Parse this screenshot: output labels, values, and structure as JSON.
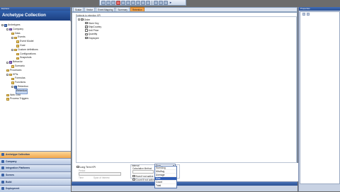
{
  "left_panel": {
    "header": "Explorer",
    "title": "Archetype Collection",
    "tree": [
      {
        "label": "Archetypes",
        "level": 0,
        "icon": "blue",
        "expander": "−"
      },
      {
        "label": "Company",
        "level": 1,
        "icon": "purple",
        "expander": "−"
      },
      {
        "label": "Data",
        "level": 2,
        "icon": "folder",
        "expander": ""
      },
      {
        "label": "Events",
        "level": 2,
        "icon": "folder",
        "expander": "−"
      },
      {
        "label": "Event Model",
        "level": 3,
        "icon": "folder",
        "expander": ""
      },
      {
        "label": "Goal",
        "level": 3,
        "icon": "folder",
        "expander": ""
      },
      {
        "label": "Custom definitions",
        "level": 2,
        "icon": "folder",
        "expander": "−"
      },
      {
        "label": "Configurations",
        "level": 3,
        "icon": "folder",
        "expander": ""
      },
      {
        "label": "Snapshots",
        "level": 3,
        "icon": "folder",
        "expander": ""
      },
      {
        "label": "Behavior",
        "level": 1,
        "icon": "purple",
        "expander": "−"
      },
      {
        "label": "Scenario",
        "level": 2,
        "icon": "folder",
        "expander": ""
      },
      {
        "label": "Processes",
        "level": 1,
        "icon": "folder",
        "expander": ""
      },
      {
        "label": "KPIs",
        "level": 1,
        "icon": "folder",
        "expander": "−"
      },
      {
        "label": "Formulas",
        "level": 2,
        "icon": "folder",
        "expander": ""
      },
      {
        "label": "Functions",
        "level": 2,
        "icon": "folder",
        "expander": ""
      },
      {
        "label": "Retention",
        "level": 2,
        "icon": "blue",
        "expander": "−"
      },
      {
        "label": "Retention",
        "level": 3,
        "icon": "",
        "expander": "",
        "selected": true
      },
      {
        "label": "Web Grid",
        "level": 1,
        "icon": "folder",
        "expander": ""
      },
      {
        "label": "Process Triggers",
        "level": 1,
        "icon": "folder",
        "expander": ""
      }
    ],
    "nav": [
      {
        "label": "Archetype Collection",
        "active": true
      },
      {
        "label": "Company",
        "active": false
      },
      {
        "label": "Integration Platforms",
        "active": false
      },
      {
        "label": "Scenes",
        "active": false
      },
      {
        "label": "Build",
        "active": false
      },
      {
        "label": "Deployment",
        "active": false
      }
    ]
  },
  "tabs": [
    {
      "label": "Scalar",
      "active": false
    },
    {
      "label": "Vector",
      "active": false
    },
    {
      "label": "Event Mapping",
      "active": false
    },
    {
      "label": "Summary",
      "active": false
    },
    {
      "label": "Retention",
      "active": true
    }
  ],
  "subject": {
    "label": "Subjects to retention KPI",
    "items": [
      {
        "label": "Order",
        "level": 0,
        "checked": true,
        "expander": "−"
      },
      {
        "label": "Store Key",
        "level": 1,
        "checked": true
      },
      {
        "label": "ShipCountry",
        "level": 1,
        "checked": true
      },
      {
        "label": "Unit Price",
        "level": 1,
        "checked": false
      },
      {
        "label": "Quantity",
        "level": 1,
        "checked": false
      },
      {
        "label": "Employee",
        "level": 1,
        "checked": true
      }
    ]
  },
  "options": {
    "long_term_kpi": "Long Term KPI",
    "faded_labels": [
      "Period",
      "Time",
      "Span of Interest"
    ],
    "interval_label": "Interval",
    "calc_method_label": "Calculation Method",
    "calc_value": "Sum",
    "check_a": "Sum if not active",
    "check_b": "Count if not active",
    "dropdown_options": [
      {
        "label": "Sum/Avg",
        "selected": false
      },
      {
        "label": "Min/Avg",
        "selected": false
      },
      {
        "label": "Average",
        "selected": false
      },
      {
        "label": "Max",
        "selected": true
      },
      {
        "label": "Count",
        "selected": false
      },
      {
        "label": "Total",
        "selected": false
      }
    ]
  },
  "right_panel": {
    "header": "Properties"
  }
}
